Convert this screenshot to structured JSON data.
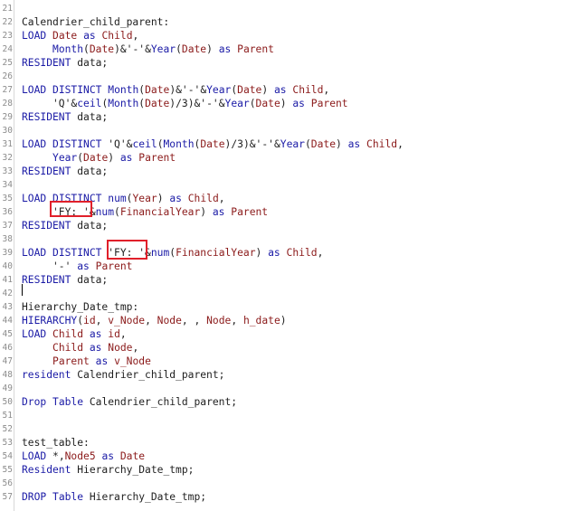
{
  "editor": {
    "lines": [
      {
        "num": "21",
        "tokens": []
      },
      {
        "num": "22",
        "tokens": [
          {
            "t": "txt",
            "v": "Calendrier_child_parent:"
          }
        ]
      },
      {
        "num": "23",
        "tokens": [
          {
            "t": "kw",
            "v": "LOAD"
          },
          {
            "t": "txt",
            "v": " "
          },
          {
            "t": "id",
            "v": "Date"
          },
          {
            "t": "txt",
            "v": " "
          },
          {
            "t": "kw",
            "v": "as"
          },
          {
            "t": "txt",
            "v": " "
          },
          {
            "t": "id",
            "v": "Child"
          },
          {
            "t": "txt",
            "v": ","
          }
        ]
      },
      {
        "num": "24",
        "tokens": [
          {
            "t": "txt",
            "v": "     "
          },
          {
            "t": "fn",
            "v": "Month"
          },
          {
            "t": "txt",
            "v": "("
          },
          {
            "t": "id",
            "v": "Date"
          },
          {
            "t": "txt",
            "v": ")&'-'&"
          },
          {
            "t": "fn",
            "v": "Year"
          },
          {
            "t": "txt",
            "v": "("
          },
          {
            "t": "id",
            "v": "Date"
          },
          {
            "t": "txt",
            "v": ") "
          },
          {
            "t": "kw",
            "v": "as"
          },
          {
            "t": "txt",
            "v": " "
          },
          {
            "t": "id",
            "v": "Parent"
          }
        ]
      },
      {
        "num": "25",
        "tokens": [
          {
            "t": "kw",
            "v": "RESIDENT"
          },
          {
            "t": "txt",
            "v": " data;"
          }
        ]
      },
      {
        "num": "26",
        "tokens": []
      },
      {
        "num": "27",
        "tokens": [
          {
            "t": "kw",
            "v": "LOAD"
          },
          {
            "t": "txt",
            "v": " "
          },
          {
            "t": "kw",
            "v": "DISTINCT"
          },
          {
            "t": "txt",
            "v": " "
          },
          {
            "t": "fn",
            "v": "Month"
          },
          {
            "t": "txt",
            "v": "("
          },
          {
            "t": "id",
            "v": "Date"
          },
          {
            "t": "txt",
            "v": ")&'-'&"
          },
          {
            "t": "fn",
            "v": "Year"
          },
          {
            "t": "txt",
            "v": "("
          },
          {
            "t": "id",
            "v": "Date"
          },
          {
            "t": "txt",
            "v": ") "
          },
          {
            "t": "kw",
            "v": "as"
          },
          {
            "t": "txt",
            "v": " "
          },
          {
            "t": "id",
            "v": "Child"
          },
          {
            "t": "txt",
            "v": ","
          }
        ]
      },
      {
        "num": "28",
        "tokens": [
          {
            "t": "txt",
            "v": "     'Q'&"
          },
          {
            "t": "fn",
            "v": "ceil"
          },
          {
            "t": "txt",
            "v": "("
          },
          {
            "t": "fn",
            "v": "Month"
          },
          {
            "t": "txt",
            "v": "("
          },
          {
            "t": "id",
            "v": "Date"
          },
          {
            "t": "txt",
            "v": ")/3)&'-'&"
          },
          {
            "t": "fn",
            "v": "Year"
          },
          {
            "t": "txt",
            "v": "("
          },
          {
            "t": "id",
            "v": "Date"
          },
          {
            "t": "txt",
            "v": ") "
          },
          {
            "t": "kw",
            "v": "as"
          },
          {
            "t": "txt",
            "v": " "
          },
          {
            "t": "id",
            "v": "Parent"
          }
        ]
      },
      {
        "num": "29",
        "tokens": [
          {
            "t": "kw",
            "v": "RESIDENT"
          },
          {
            "t": "txt",
            "v": " data;"
          }
        ]
      },
      {
        "num": "30",
        "tokens": []
      },
      {
        "num": "31",
        "tokens": [
          {
            "t": "kw",
            "v": "LOAD"
          },
          {
            "t": "txt",
            "v": " "
          },
          {
            "t": "kw",
            "v": "DISTINCT"
          },
          {
            "t": "txt",
            "v": " 'Q'&"
          },
          {
            "t": "fn",
            "v": "ceil"
          },
          {
            "t": "txt",
            "v": "("
          },
          {
            "t": "fn",
            "v": "Month"
          },
          {
            "t": "txt",
            "v": "("
          },
          {
            "t": "id",
            "v": "Date"
          },
          {
            "t": "txt",
            "v": ")/3)&'-'&"
          },
          {
            "t": "fn",
            "v": "Year"
          },
          {
            "t": "txt",
            "v": "("
          },
          {
            "t": "id",
            "v": "Date"
          },
          {
            "t": "txt",
            "v": ") "
          },
          {
            "t": "kw",
            "v": "as"
          },
          {
            "t": "txt",
            "v": " "
          },
          {
            "t": "id",
            "v": "Child"
          },
          {
            "t": "txt",
            "v": ","
          }
        ]
      },
      {
        "num": "32",
        "tokens": [
          {
            "t": "txt",
            "v": "     "
          },
          {
            "t": "fn",
            "v": "Year"
          },
          {
            "t": "txt",
            "v": "("
          },
          {
            "t": "id",
            "v": "Date"
          },
          {
            "t": "txt",
            "v": ") "
          },
          {
            "t": "kw",
            "v": "as"
          },
          {
            "t": "txt",
            "v": " "
          },
          {
            "t": "id",
            "v": "Parent"
          }
        ]
      },
      {
        "num": "33",
        "tokens": [
          {
            "t": "kw",
            "v": "RESIDENT"
          },
          {
            "t": "txt",
            "v": " data;"
          }
        ]
      },
      {
        "num": "34",
        "tokens": []
      },
      {
        "num": "35",
        "tokens": [
          {
            "t": "kw",
            "v": "LOAD"
          },
          {
            "t": "txt",
            "v": " "
          },
          {
            "t": "kw",
            "v": "DISTINCT"
          },
          {
            "t": "txt",
            "v": " "
          },
          {
            "t": "fn",
            "v": "num"
          },
          {
            "t": "txt",
            "v": "("
          },
          {
            "t": "id",
            "v": "Year"
          },
          {
            "t": "txt",
            "v": ") "
          },
          {
            "t": "kw",
            "v": "as"
          },
          {
            "t": "txt",
            "v": " "
          },
          {
            "t": "id",
            "v": "Child"
          },
          {
            "t": "txt",
            "v": ","
          }
        ]
      },
      {
        "num": "36",
        "tokens": [
          {
            "t": "txt",
            "v": "     'FY: '&"
          },
          {
            "t": "fn",
            "v": "num"
          },
          {
            "t": "txt",
            "v": "("
          },
          {
            "t": "id",
            "v": "FinancialYear"
          },
          {
            "t": "txt",
            "v": ") "
          },
          {
            "t": "kw",
            "v": "as"
          },
          {
            "t": "txt",
            "v": " "
          },
          {
            "t": "id",
            "v": "Parent"
          }
        ]
      },
      {
        "num": "37",
        "tokens": [
          {
            "t": "kw",
            "v": "RESIDENT"
          },
          {
            "t": "txt",
            "v": " data;"
          }
        ]
      },
      {
        "num": "38",
        "tokens": []
      },
      {
        "num": "39",
        "tokens": [
          {
            "t": "kw",
            "v": "LOAD"
          },
          {
            "t": "txt",
            "v": " "
          },
          {
            "t": "kw",
            "v": "DISTINCT"
          },
          {
            "t": "txt",
            "v": " 'FY: '&"
          },
          {
            "t": "fn",
            "v": "num"
          },
          {
            "t": "txt",
            "v": "("
          },
          {
            "t": "id",
            "v": "FinancialYear"
          },
          {
            "t": "txt",
            "v": ") "
          },
          {
            "t": "kw",
            "v": "as"
          },
          {
            "t": "txt",
            "v": " "
          },
          {
            "t": "id",
            "v": "Child"
          },
          {
            "t": "txt",
            "v": ","
          }
        ]
      },
      {
        "num": "40",
        "tokens": [
          {
            "t": "txt",
            "v": "     '-' "
          },
          {
            "t": "kw",
            "v": "as"
          },
          {
            "t": "txt",
            "v": " "
          },
          {
            "t": "id",
            "v": "Parent"
          }
        ]
      },
      {
        "num": "41",
        "tokens": [
          {
            "t": "kw",
            "v": "RESIDENT"
          },
          {
            "t": "txt",
            "v": " data;"
          }
        ]
      },
      {
        "num": "42",
        "tokens": []
      },
      {
        "num": "43",
        "tokens": [
          {
            "t": "txt",
            "v": "Hierarchy_Date_tmp:"
          }
        ]
      },
      {
        "num": "44",
        "tokens": [
          {
            "t": "kw",
            "v": "HIERARCHY"
          },
          {
            "t": "txt",
            "v": "("
          },
          {
            "t": "id",
            "v": "id"
          },
          {
            "t": "txt",
            "v": ", "
          },
          {
            "t": "id",
            "v": "v_Node"
          },
          {
            "t": "txt",
            "v": ", "
          },
          {
            "t": "id",
            "v": "Node"
          },
          {
            "t": "txt",
            "v": ", , "
          },
          {
            "t": "id",
            "v": "Node"
          },
          {
            "t": "txt",
            "v": ", "
          },
          {
            "t": "id",
            "v": "h_date"
          },
          {
            "t": "txt",
            "v": ")"
          }
        ]
      },
      {
        "num": "45",
        "tokens": [
          {
            "t": "kw",
            "v": "LOAD"
          },
          {
            "t": "txt",
            "v": " "
          },
          {
            "t": "id",
            "v": "Child"
          },
          {
            "t": "txt",
            "v": " "
          },
          {
            "t": "kw",
            "v": "as"
          },
          {
            "t": "txt",
            "v": " "
          },
          {
            "t": "id",
            "v": "id"
          },
          {
            "t": "txt",
            "v": ","
          }
        ]
      },
      {
        "num": "46",
        "tokens": [
          {
            "t": "txt",
            "v": "     "
          },
          {
            "t": "id",
            "v": "Child"
          },
          {
            "t": "txt",
            "v": " "
          },
          {
            "t": "kw",
            "v": "as"
          },
          {
            "t": "txt",
            "v": " "
          },
          {
            "t": "id",
            "v": "Node"
          },
          {
            "t": "txt",
            "v": ","
          }
        ]
      },
      {
        "num": "47",
        "tokens": [
          {
            "t": "txt",
            "v": "     "
          },
          {
            "t": "id",
            "v": "Parent"
          },
          {
            "t": "txt",
            "v": " "
          },
          {
            "t": "kw",
            "v": "as"
          },
          {
            "t": "txt",
            "v": " "
          },
          {
            "t": "id",
            "v": "v_Node"
          }
        ]
      },
      {
        "num": "48",
        "tokens": [
          {
            "t": "kw",
            "v": "resident"
          },
          {
            "t": "txt",
            "v": " Calendrier_child_parent;"
          }
        ]
      },
      {
        "num": "49",
        "tokens": []
      },
      {
        "num": "50",
        "tokens": [
          {
            "t": "kw",
            "v": "Drop"
          },
          {
            "t": "txt",
            "v": " "
          },
          {
            "t": "kw",
            "v": "Table"
          },
          {
            "t": "txt",
            "v": " Calendrier_child_parent;"
          }
        ]
      },
      {
        "num": "51",
        "tokens": []
      },
      {
        "num": "52",
        "tokens": []
      },
      {
        "num": "53",
        "tokens": [
          {
            "t": "txt",
            "v": "test_table:"
          }
        ]
      },
      {
        "num": "54",
        "tokens": [
          {
            "t": "kw",
            "v": "LOAD"
          },
          {
            "t": "txt",
            "v": " *,"
          },
          {
            "t": "id",
            "v": "Node5"
          },
          {
            "t": "txt",
            "v": " "
          },
          {
            "t": "kw",
            "v": "as"
          },
          {
            "t": "txt",
            "v": " "
          },
          {
            "t": "id",
            "v": "Date"
          }
        ]
      },
      {
        "num": "55",
        "tokens": [
          {
            "t": "kw",
            "v": "Resident"
          },
          {
            "t": "txt",
            "v": " Hierarchy_Date_tmp;"
          }
        ]
      },
      {
        "num": "56",
        "tokens": []
      },
      {
        "num": "57",
        "tokens": [
          {
            "t": "kw",
            "v": "DROP"
          },
          {
            "t": "txt",
            "v": " "
          },
          {
            "t": "kw",
            "v": "Table"
          },
          {
            "t": "txt",
            "v": " Hierarchy_Date_tmp;"
          }
        ]
      }
    ]
  },
  "colors": {
    "keyword": "#1a1aa6",
    "identifier": "#8b1a1a",
    "text": "#1e1e1e",
    "line_number": "#8c8c8c",
    "highlight_box": "#e0202a"
  }
}
